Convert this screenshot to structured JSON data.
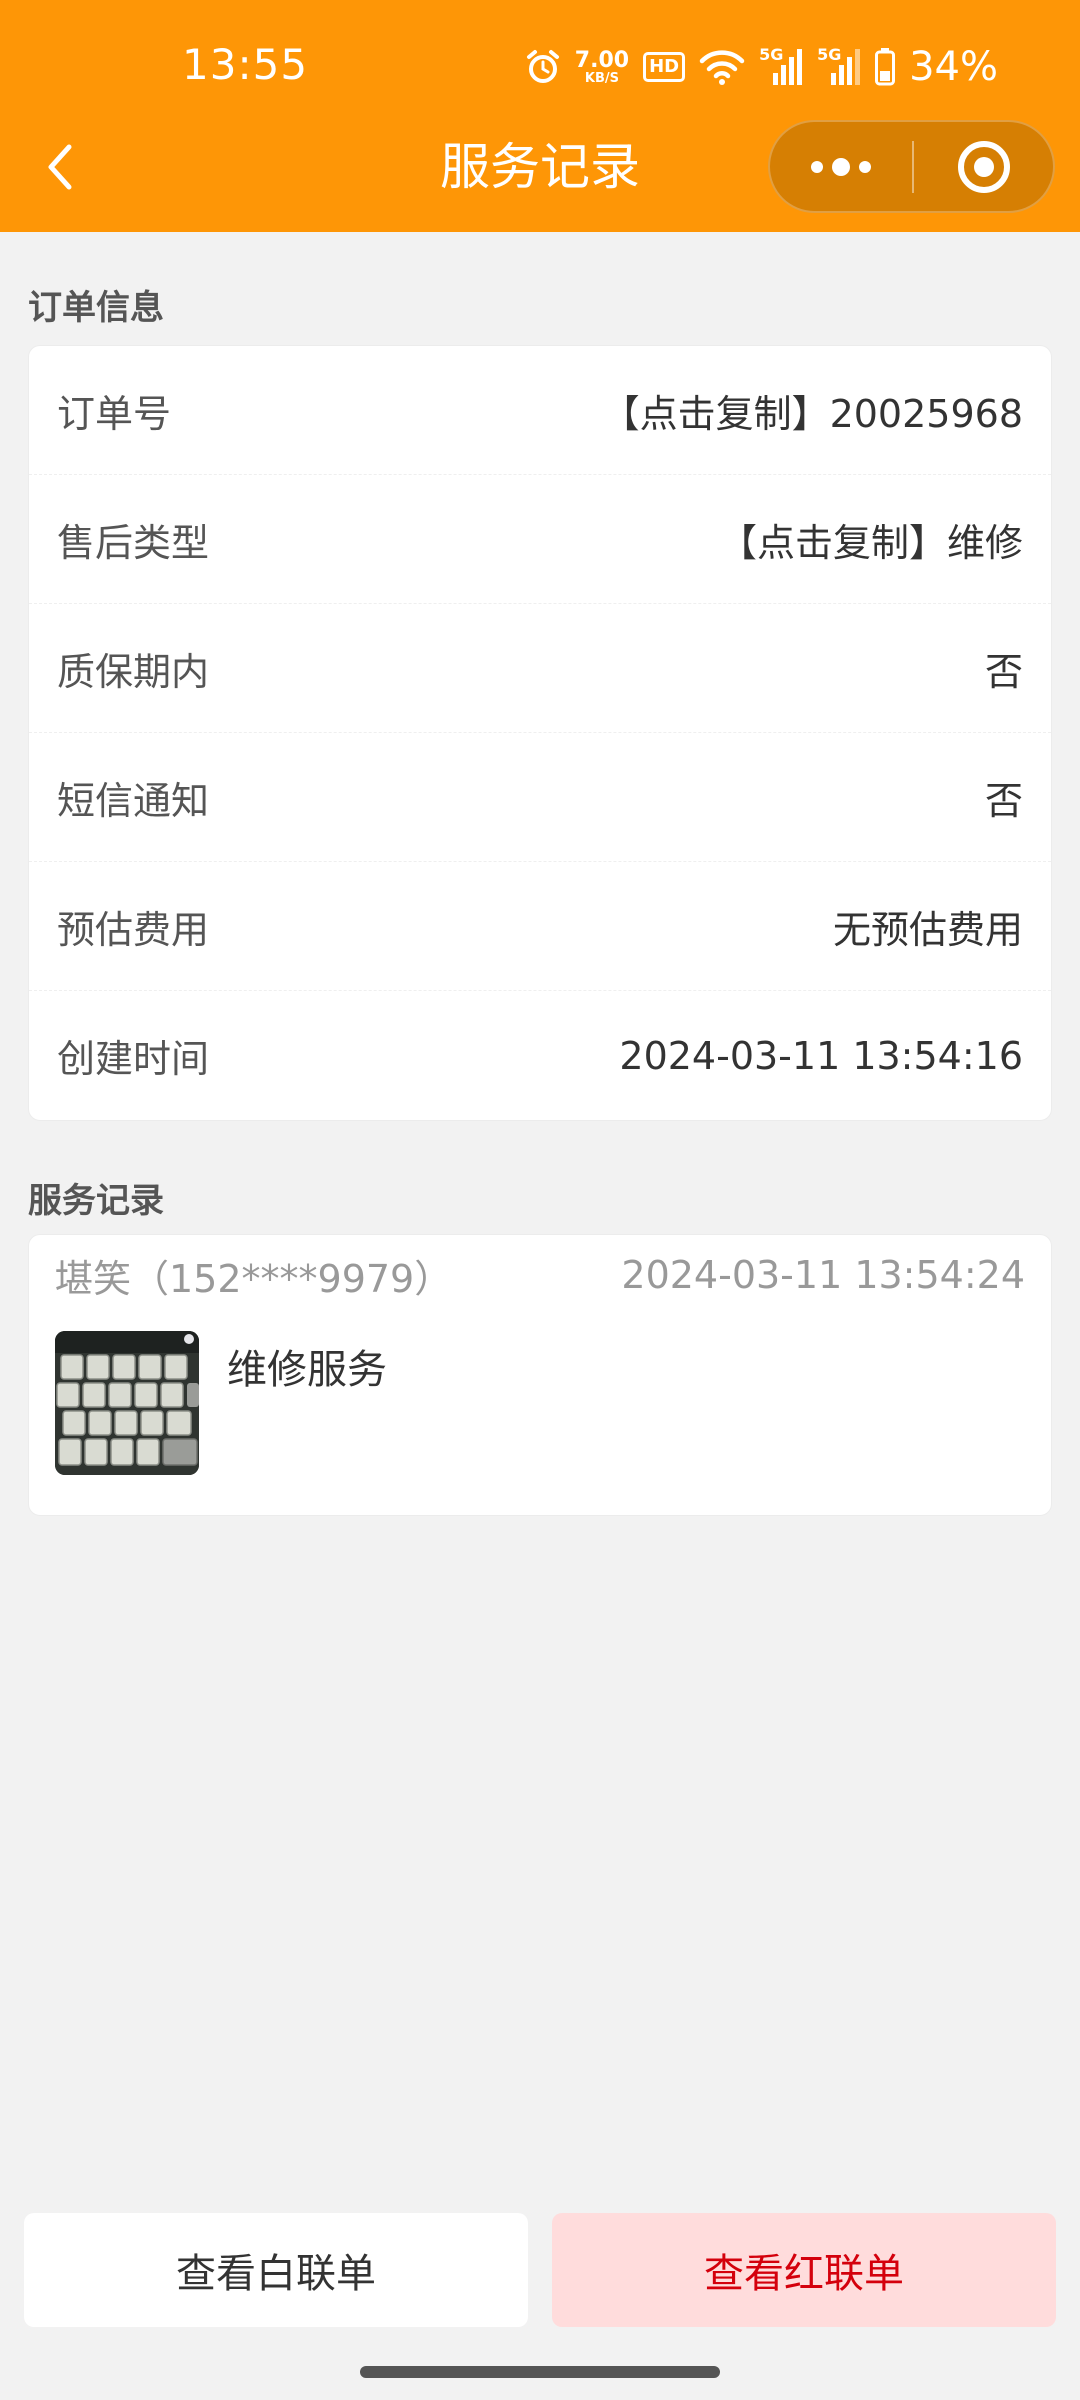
{
  "status_bar": {
    "time": "13:55",
    "net_speed_value": "7.00",
    "net_speed_unit": "KB/S",
    "hd_label": "HD",
    "signal1_tag": "5G",
    "signal2_tag": "5G",
    "battery": "34%"
  },
  "nav": {
    "title": "服务记录"
  },
  "order_info": {
    "section_title": "订单信息",
    "rows": [
      {
        "label": "订单号",
        "value": "【点击复制】20025968"
      },
      {
        "label": "售后类型",
        "value": "【点击复制】维修"
      },
      {
        "label": "质保期内",
        "value": "否"
      },
      {
        "label": "短信通知",
        "value": "否"
      },
      {
        "label": "预估费用",
        "value": "无预估费用"
      },
      {
        "label": "创建时间",
        "value": "2024-03-11 13:54:16"
      }
    ]
  },
  "service_records": {
    "section_title": "服务记录",
    "items": [
      {
        "user": "堪笑（152****9979）",
        "time": "2024-03-11 13:54:24",
        "content": "维修服务"
      }
    ]
  },
  "actions": {
    "view_white": "查看白联单",
    "view_red": "查看红联单"
  },
  "colors": {
    "header": "#fe9606",
    "red_button_bg": "#ffdcdc",
    "red_button_text": "#d4000c"
  }
}
